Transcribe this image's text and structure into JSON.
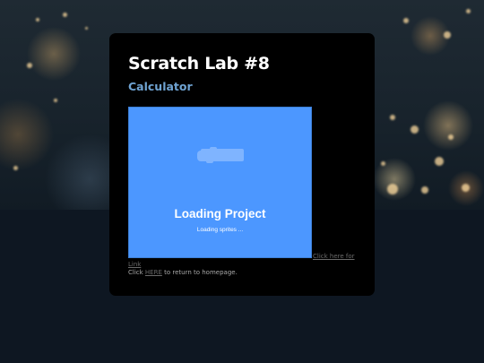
{
  "page": {
    "title": "Scratch Lab #8",
    "subtitle": "Calculator"
  },
  "project": {
    "loading_title": "Loading Project",
    "loading_subtitle": "Loading sprites ...",
    "logo_icon": "scratch-logo-icon",
    "background_color": "#4c97ff"
  },
  "links": {
    "link_text_part1": "Click here for",
    "link_text_part2": "Link",
    "return_prefix": "Click ",
    "return_link": "HERE",
    "return_suffix": " to return to homepage."
  },
  "colors": {
    "card_background": "#000000",
    "title": "#ffffff",
    "subtitle": "#6fa3d2"
  }
}
